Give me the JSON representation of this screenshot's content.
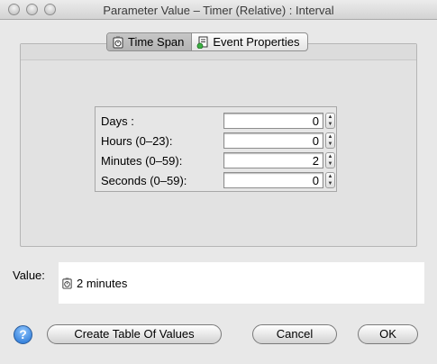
{
  "window": {
    "title": "Parameter Value – Timer (Relative) : Interval"
  },
  "tabs": [
    {
      "label": "Time Span",
      "icon": "timer-icon",
      "selected": true
    },
    {
      "label": "Event Properties",
      "icon": "event-properties-icon",
      "selected": false
    }
  ],
  "fields": [
    {
      "label": "Days :",
      "value": "0"
    },
    {
      "label": "Hours (0–23):",
      "value": "0"
    },
    {
      "label": "Minutes (0–59):",
      "value": "2"
    },
    {
      "label": "Seconds (0–59):",
      "value": "0"
    }
  ],
  "value_area": {
    "label": "Value:",
    "text": "2 minutes",
    "icon": "timer-icon"
  },
  "buttons": {
    "help": "?",
    "create_table": "Create Table Of Values",
    "cancel": "Cancel",
    "ok": "OK"
  },
  "colors": {
    "help_blue": "#1f6fd1",
    "selected_tab": "#b4b4b4"
  }
}
